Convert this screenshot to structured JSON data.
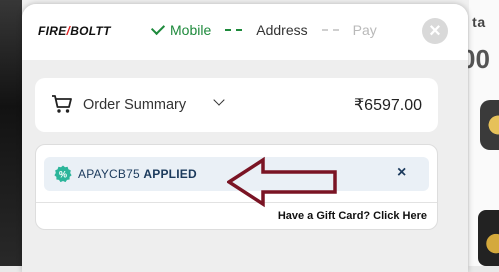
{
  "background": {
    "partial_text_top": "il ta",
    "partial_text_big": "00"
  },
  "header": {
    "logo_left": "FIRE",
    "logo_slash": "/",
    "logo_right": "BOLTT",
    "steps": [
      {
        "label": "Mobile",
        "state": "done"
      },
      {
        "label": "Address",
        "state": "current"
      },
      {
        "label": "Pay",
        "state": "pending"
      }
    ],
    "close_label": "×"
  },
  "summary": {
    "label": "Order Summary",
    "amount": "₹6597.00"
  },
  "coupon": {
    "code": "APAYCB75",
    "status": "APPLIED",
    "remove_label": "×",
    "gift_card_text": "Have a Gift Card? Click Here"
  },
  "colors": {
    "success": "#1e8a3c",
    "coupon_text": "#1b3a5c",
    "arrow": "#7a1424",
    "coupon_bg": "#eaf0f6"
  },
  "icons": [
    "check-icon",
    "close-icon",
    "cart-icon",
    "chevron-down-icon",
    "discount-badge-icon",
    "remove-coupon-icon",
    "arrow-left-annotation"
  ]
}
